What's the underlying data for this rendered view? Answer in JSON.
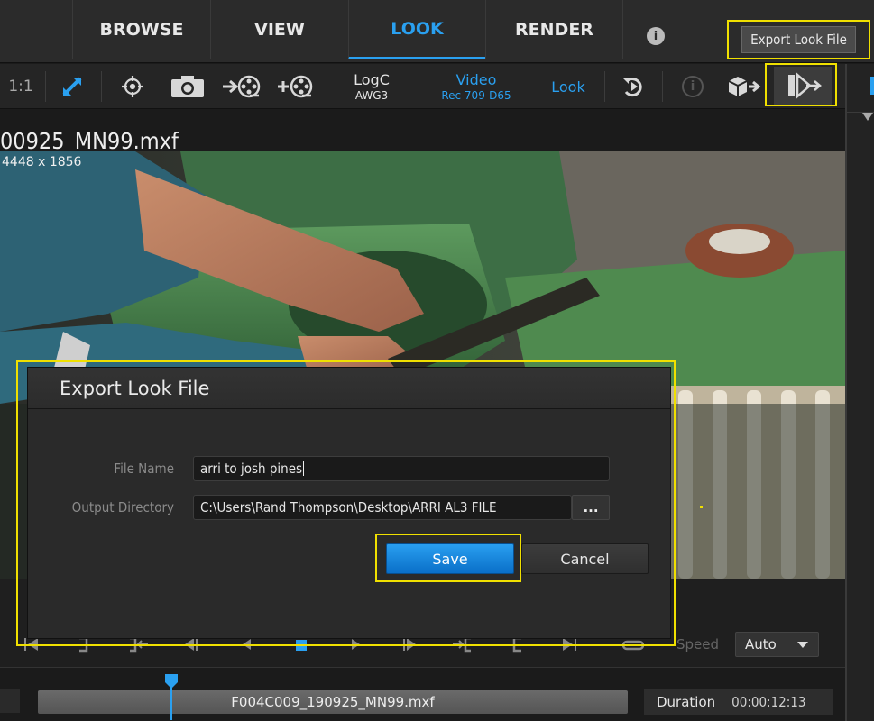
{
  "nav": {
    "tabs": [
      {
        "label": "BROWSE"
      },
      {
        "label": "VIEW"
      },
      {
        "label": "LOOK"
      },
      {
        "label": "RENDER"
      }
    ],
    "info_glyph": "i",
    "tooltip": "Export Look File"
  },
  "toolbar": {
    "zoom_label": "1:1",
    "logc_top": "LogC",
    "logc_bottom": "AWG3",
    "video_top": "Video",
    "video_bottom": "Rec 709-D65",
    "look_label": "Look",
    "disabled_info_glyph": "i"
  },
  "viewer": {
    "file_title": "00925_MN99.mxf",
    "resolution": "4448 x 1856"
  },
  "dialog": {
    "title": "Export Look File",
    "file_name_label": "File Name",
    "file_name_value": "arri to josh pines",
    "output_dir_label": "Output Directory",
    "output_dir_value": "C:\\Users\\Rand Thompson\\Desktop\\ARRI AL3 FILE",
    "browse_label": "...",
    "save_label": "Save",
    "cancel_label": "Cancel"
  },
  "transport": {
    "speed_label": "Speed",
    "speed_value": "Auto"
  },
  "timeline": {
    "clip_name": "F004C009_190925_MN99.mxf",
    "duration_label": "Duration",
    "duration_value": "00:00:12:13"
  },
  "icons": [
    "fit-arrow-icon",
    "crosshair-icon",
    "camera-icon",
    "film-export-icon",
    "film-add-icon",
    "history-icon",
    "info-icon",
    "cube-export-icon",
    "look-export-icon",
    "chevron-down-icon"
  ],
  "colors": {
    "accent": "#2aa0f0",
    "highlight": "#f0e000",
    "save": "#1586dc"
  }
}
